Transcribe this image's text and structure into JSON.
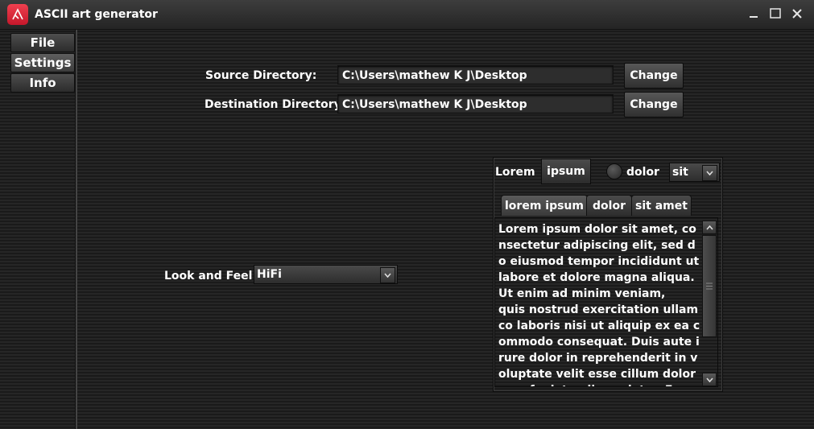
{
  "window": {
    "title": "ASCII art generator",
    "accent_color": "#e2283b",
    "controls": [
      "minimize-icon",
      "maximize-icon",
      "close-icon"
    ]
  },
  "sidebar": {
    "tabs": [
      {
        "label": "File"
      },
      {
        "label": "Settings",
        "selected": true
      },
      {
        "label": "Info"
      }
    ]
  },
  "settings": {
    "source_label": "Source Directory:",
    "source_value": "C:\\Users\\mathew K J\\Desktop",
    "destination_label": "Destination Directory:",
    "destination_value": "C:\\Users\\mathew K J\\Desktop",
    "change_label": "Change",
    "look_feel_label": "Look and Feel",
    "look_feel_value": "HiFi"
  },
  "demo": {
    "label": "Lorem",
    "toggle_label": "ipsum",
    "radio_label": "dolor",
    "combo_value": "sit",
    "tabs": [
      {
        "label": "lorem ipsum",
        "selected": true
      },
      {
        "label": "dolor"
      },
      {
        "label": "sit amet"
      }
    ],
    "text": "Lorem ipsum dolor sit amet, consectetur adipiscing elit, sed do eiusmod tempor incididunt ut labore et dolore magna aliqua. Ut enim ad minim veniam,\nquis nostrud exercitation ullamco laboris nisi ut aliquip ex ea commodo consequat. Duis aute irure dolor in reprehenderit in voluptate velit esse cillum dolore eu fugiat nulla pariatur. Excepteur sint occaecat cupidatat"
  }
}
